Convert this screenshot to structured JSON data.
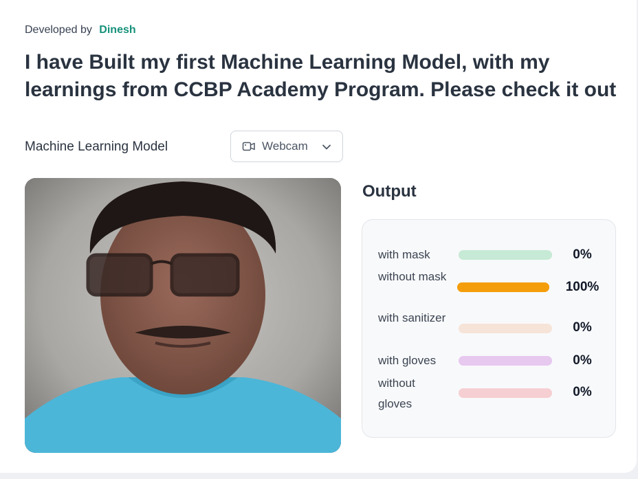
{
  "header": {
    "developed_by_label": "Developed by",
    "author": "Dinesh",
    "headline": "I have Built my first Machine Learning Model, with my learnings from CCBP Academy Program. Please check it out"
  },
  "model": {
    "label": "Machine Learning Model",
    "source_selector": {
      "label": "Webcam",
      "icon": "video-camera-icon"
    }
  },
  "output": {
    "title": "Output",
    "predictions": [
      {
        "label": "with mask",
        "value": 0,
        "percent": "0%",
        "color": "#c6ead5"
      },
      {
        "label": "without mask",
        "value": 1,
        "percent": "100%",
        "color": "#f59e0b"
      },
      {
        "label": "with sanitizer",
        "value": 0,
        "percent": "0%",
        "color": "#f7e4d8"
      },
      {
        "label": "with gloves",
        "value": 0,
        "percent": "0%",
        "color": "#e7c8ef"
      },
      {
        "label": "without gloves",
        "value": 0,
        "percent": "0%",
        "color": "#f6cfd2"
      }
    ]
  }
}
